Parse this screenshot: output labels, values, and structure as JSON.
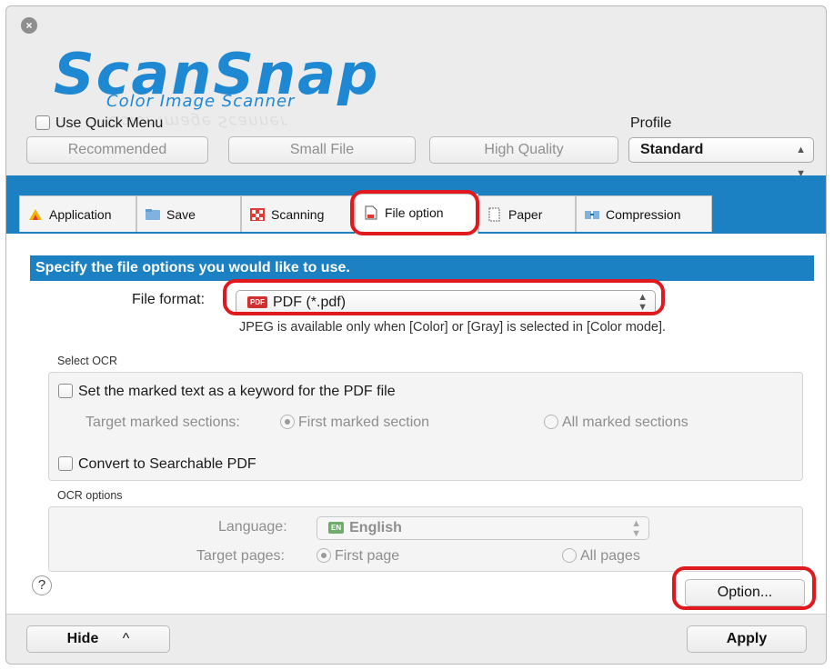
{
  "window": {
    "close_glyph": "×"
  },
  "logo": {
    "brand": "ScanSnap",
    "subtitle": "Color Image Scanner"
  },
  "header": {
    "quick_menu_label": "Use Quick Menu",
    "profile_label": "Profile",
    "presets": [
      "Recommended",
      "Small File",
      "High Quality"
    ],
    "profile_value": "Standard"
  },
  "tabs": [
    {
      "label": "Application",
      "icon": "application-icon"
    },
    {
      "label": "Save",
      "icon": "folder-icon"
    },
    {
      "label": "Scanning",
      "icon": "scanning-icon"
    },
    {
      "label": "File option",
      "icon": "file-icon"
    },
    {
      "label": "Paper",
      "icon": "paper-icon"
    },
    {
      "label": "Compression",
      "icon": "compression-icon"
    }
  ],
  "active_tab": "File option",
  "content": {
    "banner": "Specify the file options you would like to use.",
    "file_format_label": "File format:",
    "file_format_value": "PDF (*.pdf)",
    "file_format_icon_text": "PDF",
    "hint": "JPEG is available only when [Color] or [Gray] is selected in [Color mode].",
    "select_ocr": {
      "title": "Select OCR",
      "keyword_checkbox": "Set the marked text as a keyword for the PDF file",
      "target_label": "Target marked sections:",
      "option_first": "First marked section",
      "option_all": "All marked sections",
      "searchable_checkbox": "Convert to Searchable PDF"
    },
    "ocr_options": {
      "title": "OCR options",
      "language_label": "Language:",
      "language_badge": "EN",
      "language_value": "English",
      "pages_label": "Target pages:",
      "option_first_page": "First page",
      "option_all_pages": "All pages"
    },
    "option_button": "Option...",
    "help_glyph": "?"
  },
  "footer": {
    "hide_button": "Hide",
    "hide_chevron": "^",
    "apply_button": "Apply"
  },
  "colors": {
    "accent_blue": "#1c81c3",
    "highlight_red": "#e0191f",
    "logo_blue": "#1e88d2"
  }
}
